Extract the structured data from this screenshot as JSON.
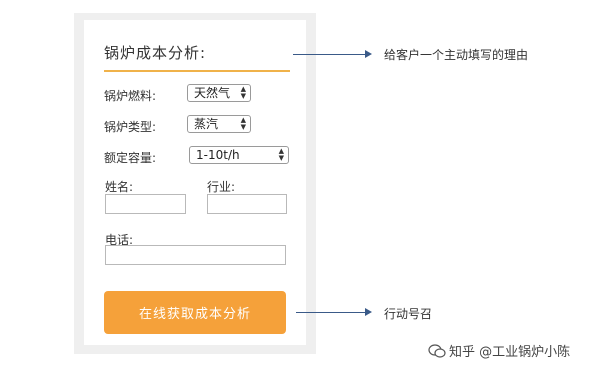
{
  "form": {
    "title": "锅炉成本分析:",
    "fuel_label": "锅炉燃料:",
    "fuel_value": "天然气",
    "type_label": "锅炉类型:",
    "type_value": "蒸汽",
    "capacity_label": "额定容量:",
    "capacity_value": "1-10t/h",
    "name_label": "姓名:",
    "industry_label": "行业:",
    "phone_label": "电话:",
    "cta_label": "在线获取成本分析"
  },
  "annotations": {
    "reason_note": "给客户一个主动填写的理由",
    "cta_note": "行动号召"
  },
  "watermark": {
    "text": "知乎 @工业锅炉小陈"
  },
  "colors": {
    "accent": "#f5a13a",
    "divider": "#f0b24a",
    "arrow": "#3a5a88"
  }
}
